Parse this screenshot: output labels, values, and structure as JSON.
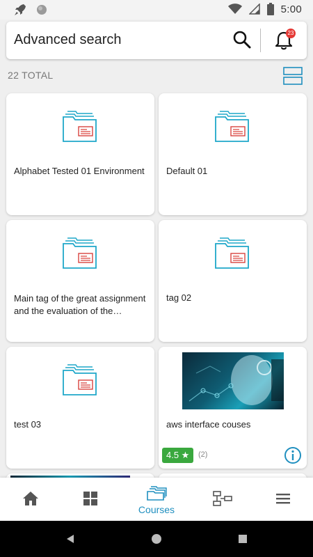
{
  "status_bar": {
    "time": "5:00"
  },
  "search_bar": {
    "title": "Advanced search",
    "notification_count": "23"
  },
  "total_label": "22 TOTAL",
  "cards": [
    {
      "title": "Alphabet Tested 01 Environment"
    },
    {
      "title": "Default 01"
    },
    {
      "title": "Main tag of the great assignment and the evaluation of the project…"
    },
    {
      "title": "tag 02"
    },
    {
      "title": "test 03"
    },
    {
      "title": "aws interface couses",
      "rating": "4.5 ★",
      "rating_count": "(2)"
    }
  ],
  "bottom_nav": {
    "items": [
      {
        "icon": "home-icon"
      },
      {
        "icon": "dashboard-grid-icon"
      },
      {
        "icon": "courses-folders-icon",
        "label": "Courses",
        "active": true
      },
      {
        "icon": "learning-path-icon"
      },
      {
        "icon": "menu-icon"
      }
    ]
  },
  "colors": {
    "accent": "#1f8fbf",
    "folder": "#1ea7c9",
    "folder_doc": "#d9433f",
    "badge": "#e53935",
    "rating": "#3aa83e"
  }
}
